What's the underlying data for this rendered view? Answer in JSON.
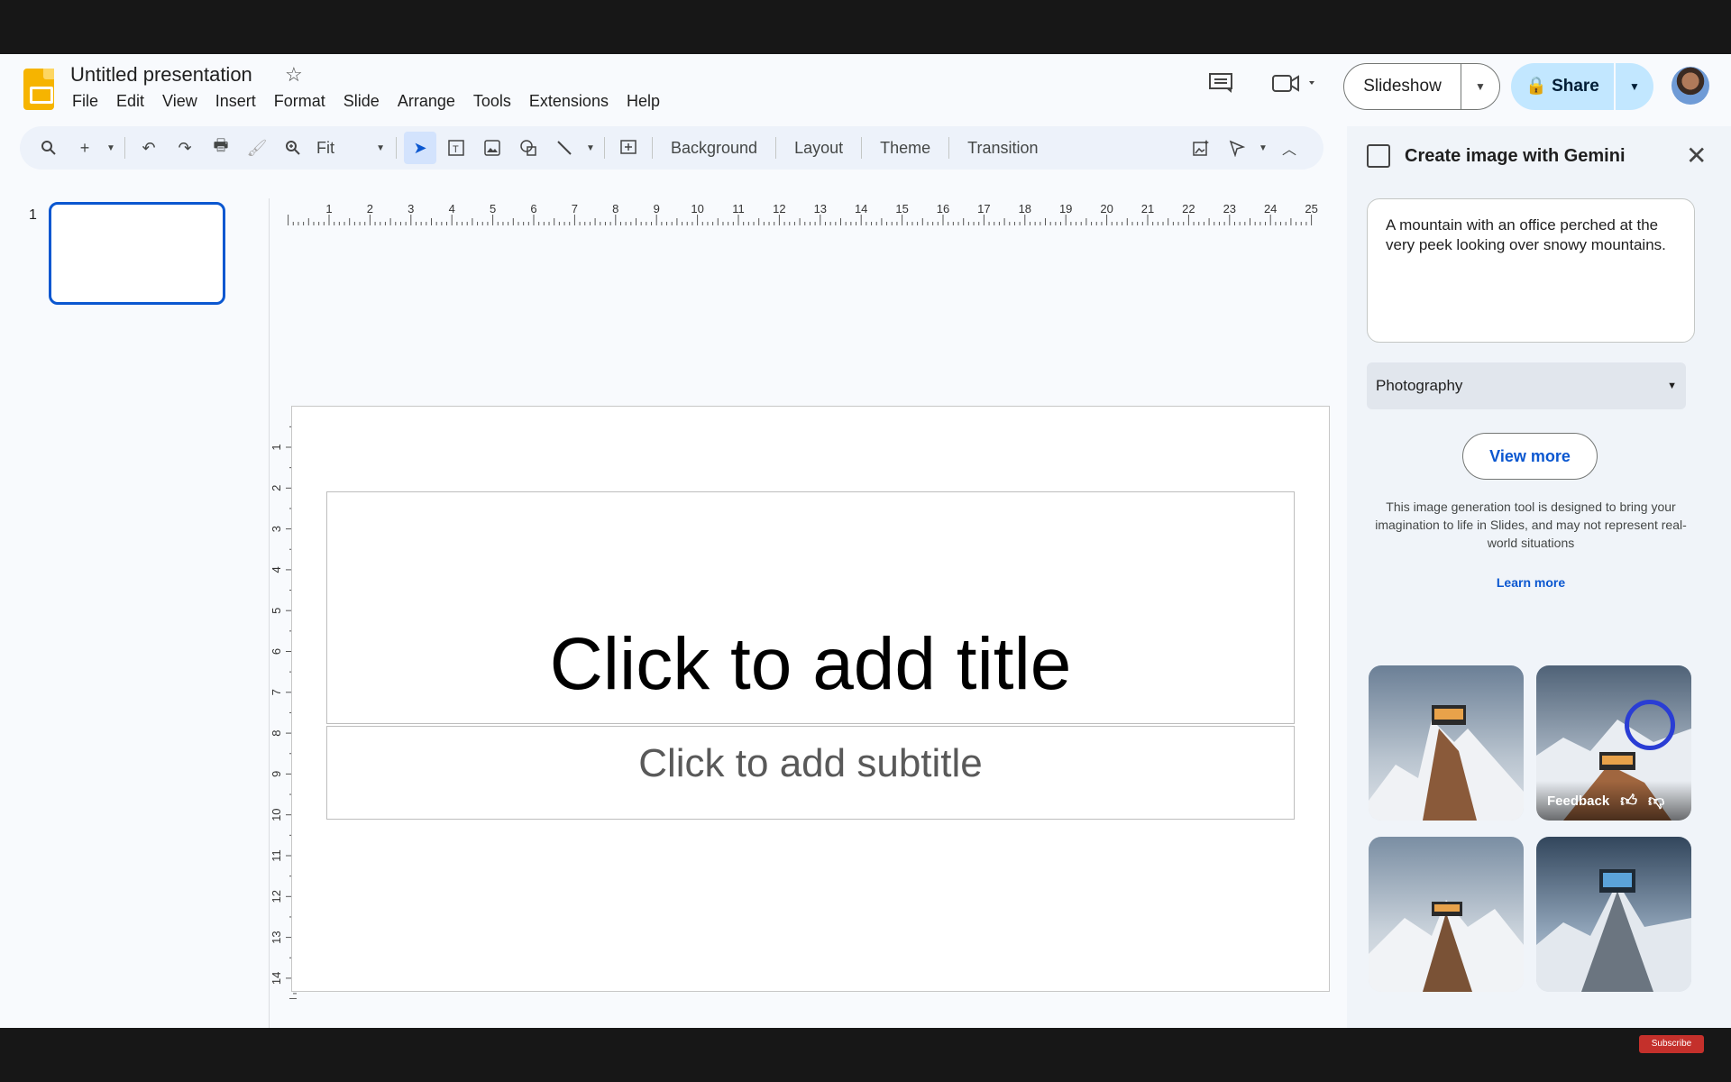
{
  "header": {
    "doc_title": "Untitled presentation",
    "menu": [
      "File",
      "Edit",
      "View",
      "Insert",
      "Format",
      "Slide",
      "Arrange",
      "Tools",
      "Extensions",
      "Help"
    ],
    "slideshow_label": "Slideshow",
    "share_label": "Share"
  },
  "toolbar": {
    "zoom_label": "Fit",
    "background_label": "Background",
    "layout_label": "Layout",
    "theme_label": "Theme",
    "transition_label": "Transition"
  },
  "filmstrip": {
    "slide_number": "1"
  },
  "ruler": {
    "horizontal": [
      "1",
      "2",
      "3",
      "4",
      "5",
      "6",
      "7",
      "8",
      "9",
      "10",
      "11",
      "12",
      "13",
      "14",
      "15",
      "16",
      "17",
      "18",
      "19",
      "20",
      "21",
      "22",
      "23",
      "24",
      "25"
    ],
    "vertical": [
      "1",
      "2",
      "3",
      "4",
      "5",
      "6",
      "7",
      "8",
      "9",
      "10",
      "11",
      "12",
      "13",
      "14"
    ]
  },
  "slide": {
    "title_placeholder": "Click to add title",
    "subtitle_placeholder": "Click to add subtitle"
  },
  "panel": {
    "title": "Create image with Gemini",
    "prompt": "A mountain with an office perched at the very peek looking over snowy mountains.",
    "style_value": "Photography",
    "view_more_label": "View more",
    "disclaimer": "This image generation tool is designed to bring your imagination to life in Slides, and may not represent real-world situations",
    "learn_more_label": "Learn more",
    "feedback_label": "Feedback"
  },
  "overlay": {
    "subscribe_label": "Subscribe"
  },
  "colors": {
    "accent": "#0b57d0",
    "share_bg": "#c2e7ff",
    "logo": "#f6b400"
  }
}
